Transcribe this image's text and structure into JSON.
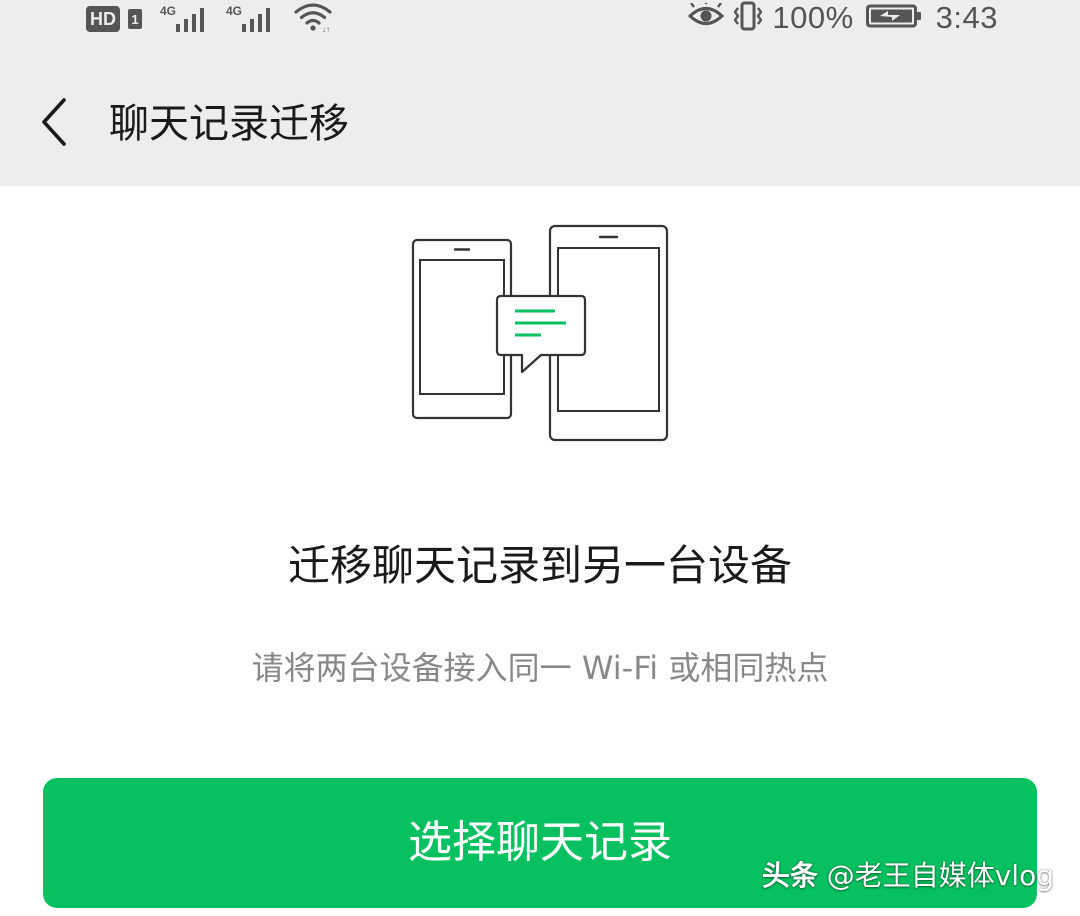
{
  "status_bar": {
    "hd_label": "HD",
    "sim_label": "1",
    "network_1": "4G",
    "network_2": "4G",
    "battery_percent": "100%",
    "time": "3:43"
  },
  "header": {
    "title": "聊天记录迁移"
  },
  "main": {
    "headline": "迁移聊天记录到另一台设备",
    "subtitle": "请将两台设备接入同一 Wi-Fi 或相同热点",
    "button_label": "选择聊天记录"
  },
  "watermark": {
    "brand": "头条",
    "handle": "@老王自媒体vlog"
  },
  "colors": {
    "accent_green": "#07c160",
    "header_bg": "#ededed",
    "icon_gray": "#555555",
    "outline_dark": "#333333"
  },
  "icons": {
    "back": "chevron-left-icon",
    "wifi": "wifi-icon",
    "eye": "eye-icon",
    "vibrate": "vibrate-icon",
    "battery": "battery-charging-icon"
  }
}
